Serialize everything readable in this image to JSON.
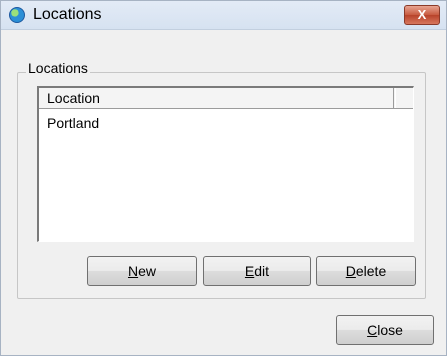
{
  "window": {
    "title": "Locations",
    "close_label": "X"
  },
  "group": {
    "label": "Locations"
  },
  "list": {
    "columns": [
      "Location"
    ],
    "rows": [
      "Portland"
    ]
  },
  "buttons": {
    "new": {
      "mnemonic": "N",
      "rest": "ew"
    },
    "edit": {
      "mnemonic": "E",
      "rest": "dit"
    },
    "delete": {
      "mnemonic": "D",
      "rest": "elete"
    },
    "close": {
      "mnemonic": "C",
      "rest": "lose"
    }
  }
}
